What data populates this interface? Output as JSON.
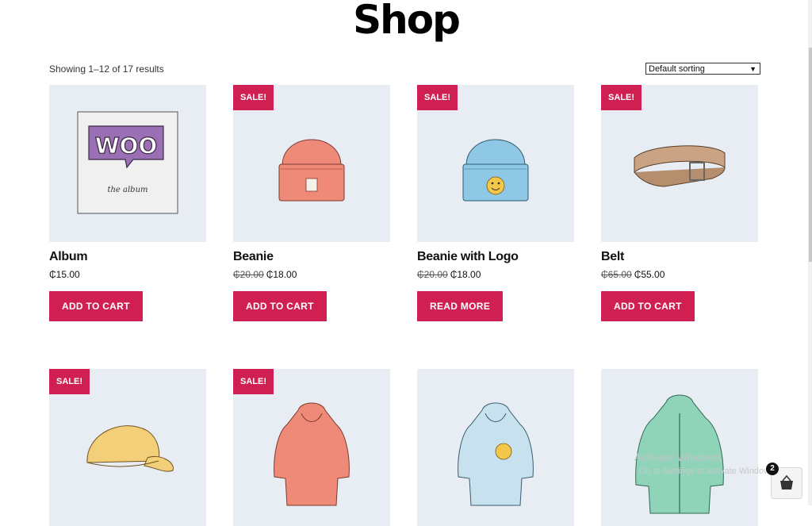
{
  "page": {
    "title": "Shop"
  },
  "catalog": {
    "result_count": "Showing 1–12 of 17 results",
    "sorting": {
      "selected": "Default sorting"
    }
  },
  "sale_badge": "SALE!",
  "products": [
    {
      "name": "Album",
      "price": "₵15.00",
      "regular_price": "",
      "sale_price": "",
      "on_sale": false,
      "button": "ADD TO CART"
    },
    {
      "name": "Beanie",
      "price": "",
      "regular_price": "₵20.00",
      "sale_price": "₵18.00",
      "on_sale": true,
      "button": "ADD TO CART"
    },
    {
      "name": "Beanie with Logo",
      "price": "",
      "regular_price": "₵20.00",
      "sale_price": "₵18.00",
      "on_sale": true,
      "button": "READ MORE"
    },
    {
      "name": "Belt",
      "price": "",
      "regular_price": "₵65.00",
      "sale_price": "₵55.00",
      "on_sale": true,
      "button": "ADD TO CART"
    },
    {
      "on_sale": true
    },
    {
      "on_sale": true
    },
    {
      "on_sale": false
    },
    {
      "on_sale": false
    }
  ],
  "album_art": {
    "logo": "WOO",
    "caption": "the album"
  },
  "cart": {
    "count": "2"
  },
  "windows_activation": {
    "title": "Activate Windows",
    "subtitle": "Go to Settings to activate Windows."
  },
  "colors": {
    "accent": "#d01f52",
    "card_bg": "#e7edf2"
  }
}
